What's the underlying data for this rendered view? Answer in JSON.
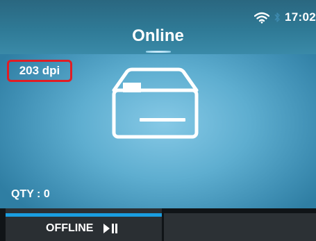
{
  "header": {
    "title": "Online",
    "time": "17:02",
    "icons": [
      "wifi-icon",
      "bluetooth-icon"
    ]
  },
  "main": {
    "resolution": "203 dpi",
    "quantity": "QTY : 0",
    "status_icon": "label-icon"
  },
  "softkeys": {
    "left_label": "OFFLINE",
    "left_icon": "play-pause-icon"
  },
  "colors": {
    "accent": "#1a9ee0",
    "highlight_border": "#e11d24",
    "header_bg": "#2f7a96"
  }
}
